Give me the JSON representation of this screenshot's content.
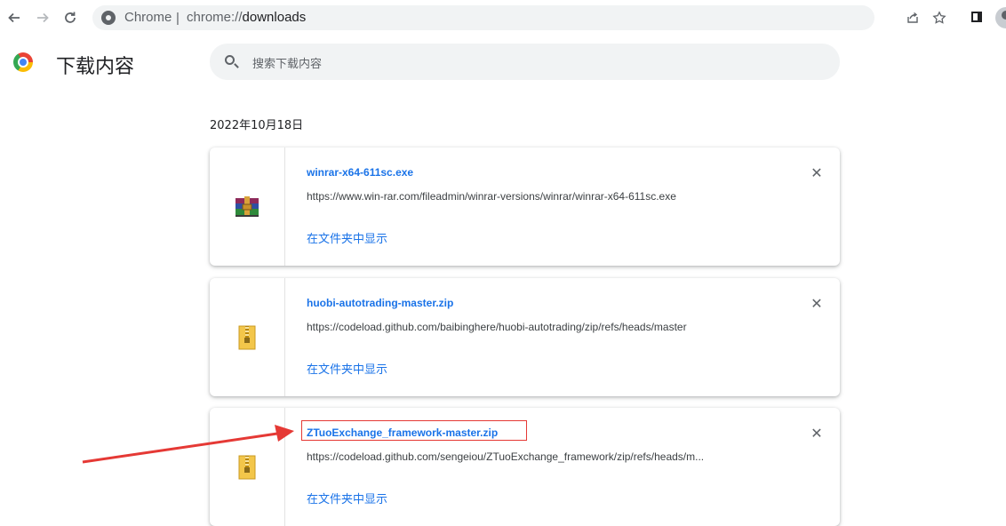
{
  "toolbar": {
    "back_icon": "arrow-left-icon",
    "forward_icon": "arrow-right-icon",
    "reload_icon": "reload-icon",
    "omnibox": {
      "chip_label": "Chrome",
      "separator": "|",
      "url_scheme": "chrome://",
      "url_host": "downloads"
    },
    "share_icon": "share-icon",
    "bookmark_icon": "star-icon",
    "side_panel_icon": "side-panel-icon"
  },
  "header": {
    "title": "下载内容",
    "search_placeholder": "搜索下载内容"
  },
  "date_group": "2022年10月18日",
  "downloads": [
    {
      "file_name": "winrar-x64-611sc.exe",
      "url": "https://www.win-rar.com/fileadmin/winrar-versions/winrar/winrar-x64-611sc.exe",
      "action_label": "在文件夹中显示",
      "icon": "winrar-installer-icon"
    },
    {
      "file_name": "huobi-autotrading-master.zip",
      "url": "https://codeload.github.com/baibinghere/huobi-autotrading/zip/refs/heads/master",
      "action_label": "在文件夹中显示",
      "icon": "zip-archive-icon"
    },
    {
      "file_name": "ZTuoExchange_framework-master.zip",
      "url": "https://codeload.github.com/sengeiou/ZTuoExchange_framework/zip/refs/heads/m...",
      "action_label": "在文件夹中显示",
      "icon": "zip-archive-icon"
    }
  ],
  "close_glyph": "✕",
  "colors": {
    "link_blue": "#1a73e8",
    "annotation_red": "#e53935"
  }
}
